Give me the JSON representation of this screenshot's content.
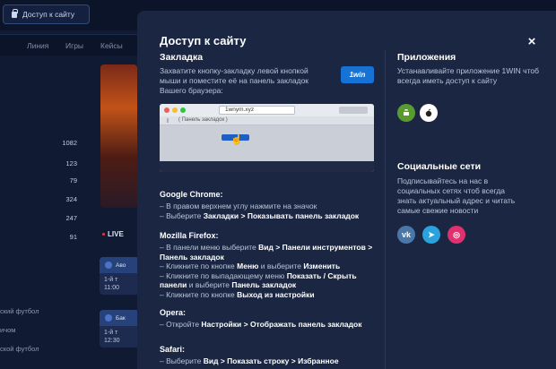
{
  "background": {
    "access_button": "Доступ к сайту",
    "nav": [
      "Линия",
      "Игры",
      "Кейсы"
    ],
    "sport_counts": [
      "1082",
      "123",
      "79",
      "324",
      "247",
      "91"
    ],
    "sports": [
      "ский футбол",
      "ичом",
      "ской футбол"
    ],
    "live_label": "LIVE",
    "matches": [
      {
        "head": "Аво",
        "time1": "1-й т",
        "time2": "11:00"
      },
      {
        "head": "Бак",
        "time1": "1-й т",
        "time2": "12:30"
      }
    ],
    "colors": {
      "bg": "#101a33",
      "accent": "#1672d4"
    }
  },
  "modal": {
    "title": "Доступ к сайту",
    "close": "×",
    "bookmark": {
      "title": "Закладка",
      "text": "Захватите кнопку-закладку левой кнопкой мыши и поместите её на панель закладок Вашего браузера:",
      "button": "1win",
      "demo_url": "1wnym.xyz",
      "demo_bookmarks": "( Панель закладок )"
    },
    "browsers": [
      {
        "name": "Google Chrome:",
        "steps": [
          [
            {
              "t": "– В правом верхнем углу нажмите на значок"
            }
          ],
          [
            {
              "t": "– Выберите "
            },
            {
              "t": "Закладки > Показывать панель закладок",
              "b": true
            }
          ]
        ]
      },
      {
        "name": "Mozilla Firefox:",
        "steps": [
          [
            {
              "t": "– В панели меню выберите "
            },
            {
              "t": "Вид > Панели инструментов > Панель закладок",
              "b": true
            }
          ],
          [
            {
              "t": "– Кликните по кнопке "
            },
            {
              "t": "Меню",
              "b": true
            },
            {
              "t": " и выберите "
            },
            {
              "t": "Изменить",
              "b": true
            }
          ],
          [
            {
              "t": "– Кликните по выпадающему меню "
            },
            {
              "t": "Показать / Скрыть панели",
              "b": true
            },
            {
              "t": " и выберите "
            },
            {
              "t": "Панель закладок",
              "b": true
            }
          ],
          [
            {
              "t": "– Кликните по кнопке "
            },
            {
              "t": "Выход из настройки",
              "b": true
            }
          ]
        ]
      },
      {
        "name": "Opera:",
        "steps": [
          [
            {
              "t": "– Откройте "
            },
            {
              "t": "Настройки > Отображать панель закладок",
              "b": true
            }
          ]
        ]
      },
      {
        "name": "Safari:",
        "steps": [
          [
            {
              "t": "– Выберите "
            },
            {
              "t": "Вид > Показать строку > Избранное",
              "b": true
            }
          ]
        ]
      }
    ],
    "apps": {
      "title": "Приложения",
      "text": "Устанавливайте приложение 1WIN чтоб всегда иметь доступ к сайту",
      "icons": [
        "android-icon",
        "apple-icon"
      ]
    },
    "social": {
      "title": "Социальные сети",
      "text": "Подписывайтесь на нас в социальных сетях чтоб всегда знать актуальный адрес и читать самые свежие новости",
      "icons": [
        {
          "name": "vk-icon",
          "glyph": "vk",
          "color": "#4a76a8"
        },
        {
          "name": "telegram-icon",
          "glyph": "➤",
          "color": "#2aa2de"
        },
        {
          "name": "instagram-icon",
          "glyph": "◎",
          "color": "#e0316f"
        }
      ]
    }
  }
}
